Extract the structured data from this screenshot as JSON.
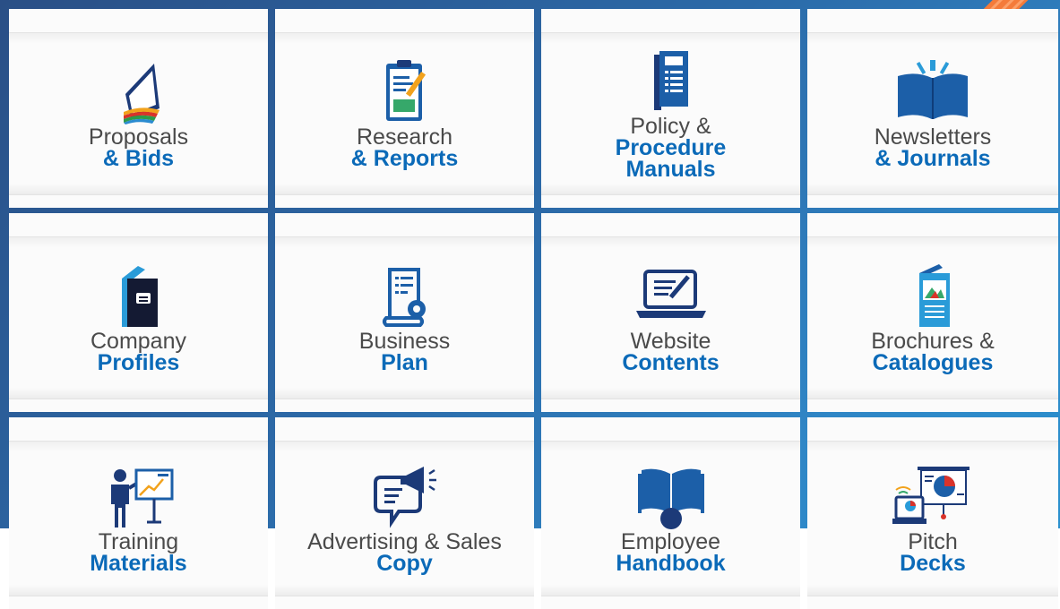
{
  "services": [
    {
      "id": "proposals",
      "icon": "stacked-book-icon",
      "line1": "Proposals",
      "line2": "& Bids"
    },
    {
      "id": "research",
      "icon": "clipboard-report-icon",
      "line1": "Research",
      "line2": "& Reports"
    },
    {
      "id": "policy",
      "icon": "manual-binder-icon",
      "line1": "Policy &",
      "line2": "Procedure",
      "line3": "Manuals"
    },
    {
      "id": "newsletters",
      "icon": "open-book-icon",
      "line1": "Newsletters",
      "line2": "& Journals"
    },
    {
      "id": "company",
      "icon": "company-profile-folder-icon",
      "line1": "Company",
      "line2": "Profiles"
    },
    {
      "id": "business",
      "icon": "business-plan-scroll-icon",
      "line1": "Business",
      "line2": "Plan"
    },
    {
      "id": "website",
      "icon": "laptop-editing-icon",
      "line1": "Website",
      "line2": "Contents"
    },
    {
      "id": "brochures",
      "icon": "brochure-icon",
      "line1": "Brochures &",
      "line2": "Catalogues"
    },
    {
      "id": "training",
      "icon": "trainer-presentation-icon",
      "line1": "Training",
      "line2": "Materials"
    },
    {
      "id": "advertising",
      "icon": "megaphone-speech-bubble-icon",
      "line1": "Advertising & Sales",
      "line2": "Copy"
    },
    {
      "id": "employee",
      "icon": "handbook-reader-icon",
      "line1": "Employee",
      "line2": "Handbook"
    },
    {
      "id": "pitch",
      "icon": "pitch-deck-screen-icon",
      "line1": "Pitch",
      "line2": "Decks"
    }
  ],
  "colors": {
    "accent": "#0b6ab8",
    "text": "#4a4a4a",
    "background": "#2c6aa8",
    "card": "#fbfbfb",
    "pencil": "#f47b3a"
  }
}
